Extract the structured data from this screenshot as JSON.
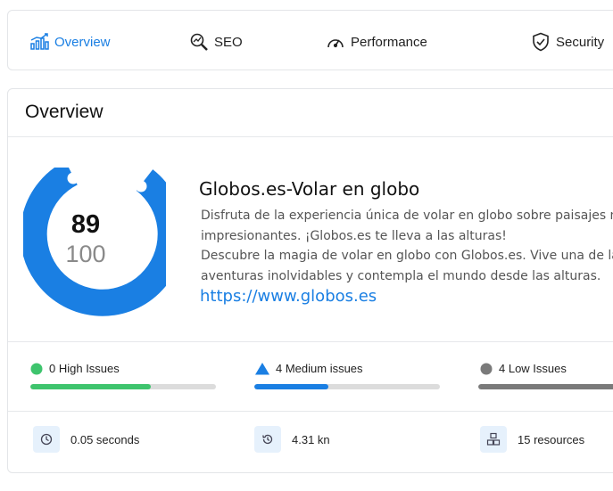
{
  "tabs": [
    {
      "label": "Overview",
      "icon": "chart-icon",
      "active": true
    },
    {
      "label": "SEO",
      "icon": "seo-search-icon",
      "active": false
    },
    {
      "label": "Performance",
      "icon": "speedometer-icon",
      "active": false
    },
    {
      "label": "Security",
      "icon": "shield-check-icon",
      "active": false
    }
  ],
  "overview": {
    "title": "Overview",
    "score": {
      "value": "89",
      "max": "100"
    },
    "site": {
      "title": "Globos.es-Volar en globo",
      "description_lines": [
        "Disfruta de la experiencia única de volar en globo sobre paisajes más",
        "impresionantes. ¡Globos.es te lleva a las alturas!",
        "Descubre la magia de volar en globo con Globos.es. Vive una de las",
        "aventuras inolvidables y contempla el mundo desde las alturas."
      ],
      "url": "https://www.globos.es"
    },
    "issues": [
      {
        "label": "0 High Issues",
        "color": "#3ec46d",
        "fill": 0.65
      },
      {
        "label": "4 Medium issues",
        "color": "#1a7fe3",
        "fill": 0.4
      },
      {
        "label": "4 Low Issues",
        "color": "#7a7a7a",
        "fill": 1.0
      }
    ],
    "stats": [
      {
        "label": "0.05 seconds",
        "icon": "clock-icon"
      },
      {
        "label": "4.31 kn",
        "icon": "history-icon"
      },
      {
        "label": "15 resources",
        "icon": "resources-icon"
      }
    ]
  },
  "colors": {
    "accent": "#1a7fe3",
    "gauge": "#1a7fe3",
    "high": "#3ec46d",
    "low": "#7a7a7a"
  }
}
